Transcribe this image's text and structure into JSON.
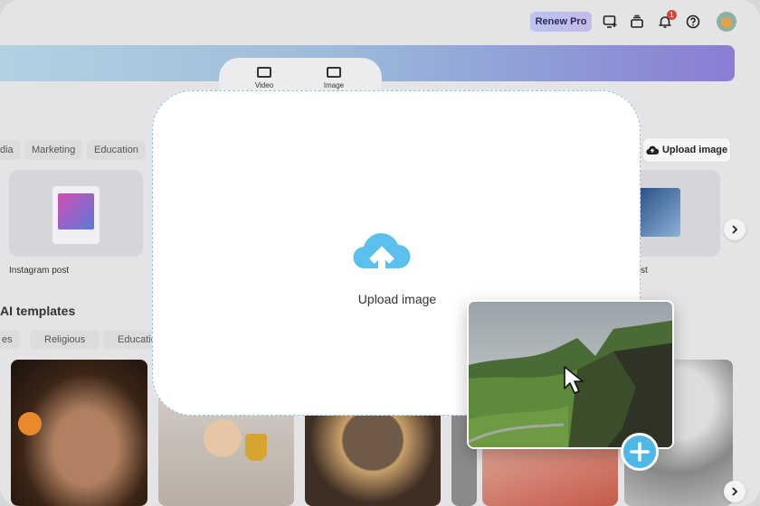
{
  "topbar": {
    "renew_label": "Renew Pro",
    "notification_count": "1",
    "icons": [
      "screen-add-icon",
      "layers-icon",
      "bell-icon",
      "help-icon"
    ]
  },
  "mode_switch": {
    "video_label": "Video",
    "image_label": "Image"
  },
  "category_chips": [
    "dia",
    "Marketing",
    "Education"
  ],
  "upload_button_label": "Upload image",
  "template_cards": [
    {
      "label": "Instagram post"
    },
    {
      "label": "st"
    }
  ],
  "ai_section": {
    "title": "AI templates",
    "chips": [
      "es",
      "Religious",
      "Educatio"
    ]
  },
  "modal": {
    "upload_label": "Upload image"
  },
  "colors": {
    "accent": "#4fb7e8",
    "modal_border": "#8fc7e2",
    "renew_bg": "#c0c0ee"
  }
}
